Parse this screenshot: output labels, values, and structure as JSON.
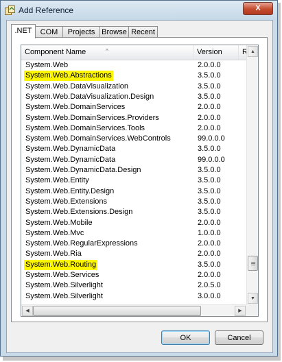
{
  "window": {
    "title": "Add Reference",
    "close_label": "X"
  },
  "tabs": [
    {
      "label": ".NET",
      "active": true
    },
    {
      "label": "COM",
      "active": false
    },
    {
      "label": "Projects",
      "active": false
    },
    {
      "label": "Browse",
      "active": false
    },
    {
      "label": "Recent",
      "active": false
    }
  ],
  "list": {
    "columns": [
      "Component Name",
      "Version",
      "R"
    ],
    "sort_indicator": "^",
    "rows": [
      {
        "name": "System.Web",
        "version": "2.0.0.0",
        "highlighted": false
      },
      {
        "name": "System.Web.Abstractions",
        "version": "3.5.0.0",
        "highlighted": true
      },
      {
        "name": "System.Web.DataVisualization",
        "version": "3.5.0.0",
        "highlighted": false
      },
      {
        "name": "System.Web.DataVisualization.Design",
        "version": "3.5.0.0",
        "highlighted": false
      },
      {
        "name": "System.Web.DomainServices",
        "version": "2.0.0.0",
        "highlighted": false
      },
      {
        "name": "System.Web.DomainServices.Providers",
        "version": "2.0.0.0",
        "highlighted": false
      },
      {
        "name": "System.Web.DomainServices.Tools",
        "version": "2.0.0.0",
        "highlighted": false
      },
      {
        "name": "System.Web.DomainServices.WebControls",
        "version": "99.0.0.0",
        "highlighted": false
      },
      {
        "name": "System.Web.DynamicData",
        "version": "3.5.0.0",
        "highlighted": false
      },
      {
        "name": "System.Web.DynamicData",
        "version": "99.0.0.0",
        "highlighted": false
      },
      {
        "name": "System.Web.DynamicData.Design",
        "version": "3.5.0.0",
        "highlighted": false
      },
      {
        "name": "System.Web.Entity",
        "version": "3.5.0.0",
        "highlighted": false
      },
      {
        "name": "System.Web.Entity.Design",
        "version": "3.5.0.0",
        "highlighted": false
      },
      {
        "name": "System.Web.Extensions",
        "version": "3.5.0.0",
        "highlighted": false
      },
      {
        "name": "System.Web.Extensions.Design",
        "version": "3.5.0.0",
        "highlighted": false
      },
      {
        "name": "System.Web.Mobile",
        "version": "2.0.0.0",
        "highlighted": false
      },
      {
        "name": "System.Web.Mvc",
        "version": "1.0.0.0",
        "highlighted": false
      },
      {
        "name": "System.Web.RegularExpressions",
        "version": "2.0.0.0",
        "highlighted": false
      },
      {
        "name": "System.Web.Ria",
        "version": "2.0.0.0",
        "highlighted": false
      },
      {
        "name": "System.Web.Routing",
        "version": "3.5.0.0",
        "highlighted": true
      },
      {
        "name": "System.Web.Services",
        "version": "2.0.0.0",
        "highlighted": false
      },
      {
        "name": "System.Web.Silverlight",
        "version": "2.0.5.0",
        "highlighted": false
      },
      {
        "name": "System.Web.Silverlight",
        "version": "3.0.0.0",
        "highlighted": false
      }
    ]
  },
  "buttons": {
    "ok_label": "OK",
    "cancel_label": "Cancel"
  },
  "colors": {
    "highlight": "#fff700",
    "frame": "#c9dbe9",
    "close_button": "#c44a2c"
  }
}
